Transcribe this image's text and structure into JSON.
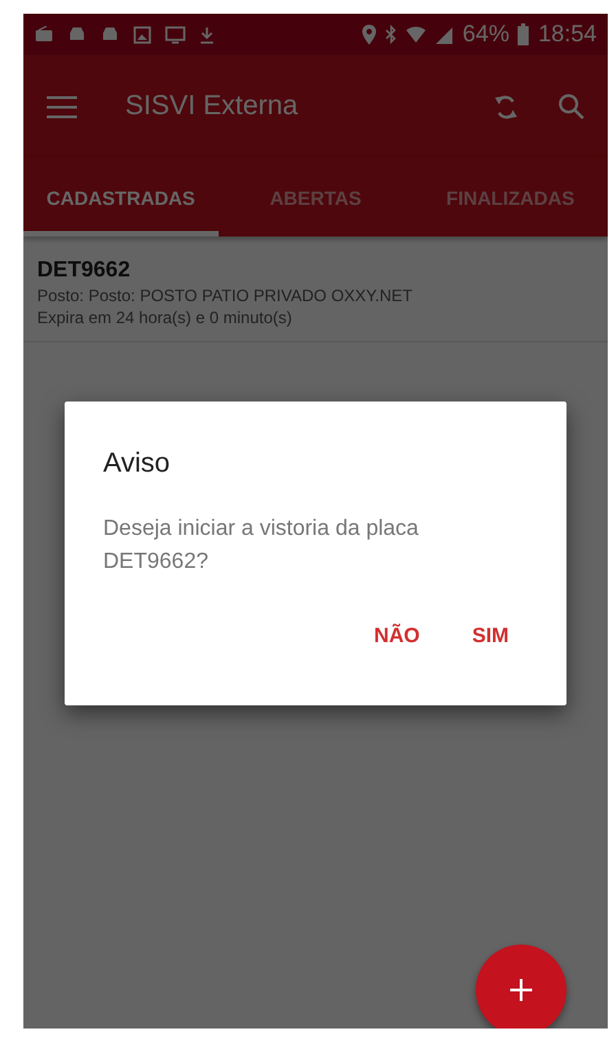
{
  "status_bar": {
    "battery": "64%",
    "time": "18:54"
  },
  "app_bar": {
    "title": "SISVI Externa"
  },
  "tabs": [
    {
      "label": "CADASTRADAS",
      "selected": true
    },
    {
      "label": "ABERTAS",
      "selected": false
    },
    {
      "label": "FINALIZADAS",
      "selected": false
    }
  ],
  "items": [
    {
      "plate": "DET9662",
      "post": "Posto:  Posto: POSTO PATIO PRIVADO OXXY.NET",
      "expiry": "Expira em 24 hora(s) e 0 minuto(s)"
    }
  ],
  "dialog": {
    "title": "Aviso",
    "message": "Deseja iniciar a vistoria da placa DET9662?",
    "buttons": [
      "NÃO",
      "SIM"
    ]
  }
}
